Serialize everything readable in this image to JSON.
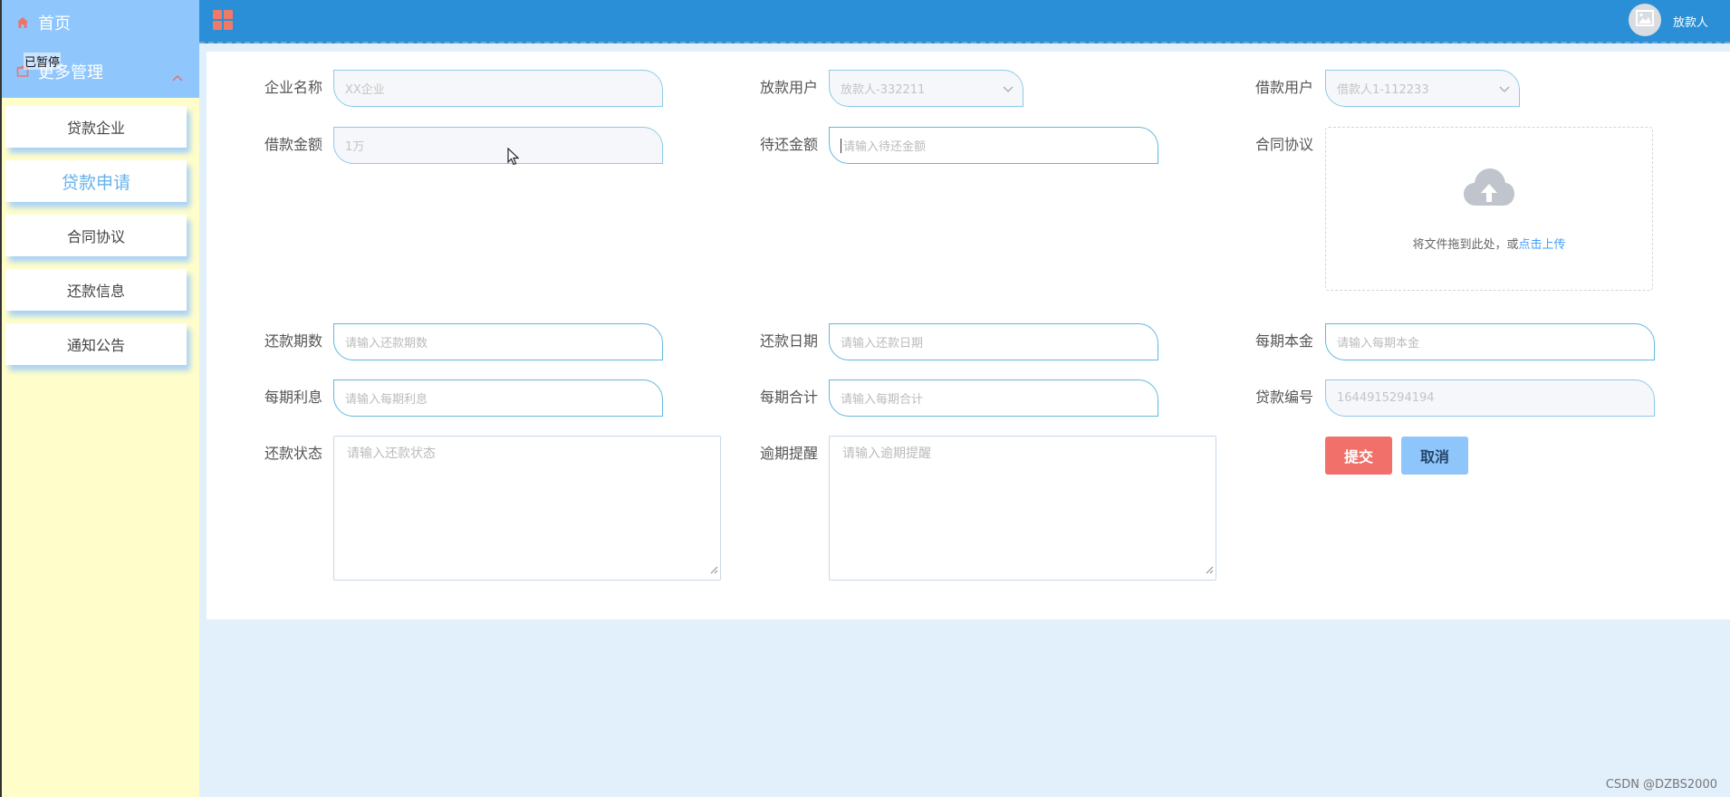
{
  "sidebar": {
    "home_label": "首页",
    "more_label": "更多管理",
    "paused_label": "已暂停",
    "items": [
      {
        "label": "贷款企业"
      },
      {
        "label": "贷款申请"
      },
      {
        "label": "合同协议"
      },
      {
        "label": "还款信息"
      },
      {
        "label": "通知公告"
      }
    ],
    "active_item": "贷款申请"
  },
  "header": {
    "user_name": "放款人"
  },
  "form": {
    "company_name": {
      "label": "企业名称",
      "value": "XX企业"
    },
    "lender_user": {
      "label": "放款用户",
      "value": "放款人-332211"
    },
    "borrower_user": {
      "label": "借款用户",
      "value": "借款人1-112233"
    },
    "loan_amount": {
      "label": "借款金额",
      "value": "1万"
    },
    "pending_amount": {
      "label": "待还金额",
      "placeholder": "请输入待还金额"
    },
    "contract": {
      "label": "合同协议",
      "upload_text": "将文件拖到此处，或",
      "upload_link": "点击上传"
    },
    "repay_periods": {
      "label": "还款期数",
      "placeholder": "请输入还款期数"
    },
    "repay_date": {
      "label": "还款日期",
      "placeholder": "请输入还款日期"
    },
    "principal_per_period": {
      "label": "每期本金",
      "placeholder": "请输入每期本金"
    },
    "interest_per_period": {
      "label": "每期利息",
      "placeholder": "请输入每期利息"
    },
    "total_per_period": {
      "label": "每期合计",
      "placeholder": "请输入每期合计"
    },
    "loan_number": {
      "label": "贷款编号",
      "value": "1644915294194"
    },
    "repay_status": {
      "label": "还款状态",
      "placeholder": "请输入还款状态"
    },
    "overdue_reminder": {
      "label": "逾期提醒",
      "placeholder": "请输入逾期提醒"
    },
    "submit_label": "提交",
    "cancel_label": "取消"
  },
  "watermark": "CSDN @DZBS2000",
  "colors": {
    "sidebar_bg": "#fffdc9",
    "menu_header_bg": "#8fc6fc",
    "topbar_bg": "#2a8fd6",
    "page_bg": "#e2f0fc",
    "field_border": "#62b8dc",
    "submit_bg": "#f1706a",
    "cancel_bg": "#8ec5fa",
    "active_menu_text": "#66b3ec"
  },
  "icons": {
    "home": "home-icon",
    "more": "folder-icon",
    "collapse": "chevron-up-icon",
    "menu_toggle": "grid-icon",
    "avatar": "image-placeholder-icon",
    "select_arrow": "chevron-down-icon",
    "upload": "cloud-upload-icon"
  }
}
